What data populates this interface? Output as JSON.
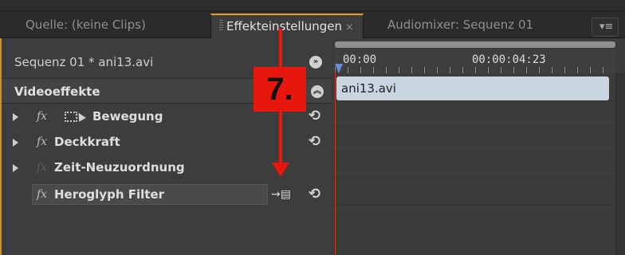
{
  "tabs": [
    {
      "label": "Quelle: (keine Clips)",
      "active": false
    },
    {
      "label": "Effekteinstellungen",
      "active": true
    },
    {
      "label": "Audiomixer: Sequenz 01",
      "active": false
    }
  ],
  "tab_close_glyph": "×",
  "panel_menu_glyph": "▾≡",
  "sequence": {
    "label": "Sequenz 01 * ani13.avi"
  },
  "section_header": {
    "label": "Videoeffekte"
  },
  "effects": [
    {
      "label": "Bewegung",
      "icon": "motion-icon",
      "fx_enabled": true,
      "expandable": true
    },
    {
      "label": "Deckkraft",
      "fx_enabled": true,
      "expandable": true
    },
    {
      "label": "Zeit-Neuzuordnung",
      "fx_enabled": false,
      "expandable": true
    },
    {
      "label": "Heroglyph Filter",
      "fx_enabled": true,
      "expandable": false,
      "selected": true
    }
  ],
  "fx_glyph": "fx",
  "reset_glyph": "⟲",
  "timeline": {
    "start_time": "00:00",
    "end_time": "00:00:04:23",
    "clip_name": "ani13.avi"
  },
  "annotation": {
    "label": "7."
  },
  "colors": {
    "accent_orange": "#d58e1c",
    "annotation_red": "#e8160c",
    "clip_blue": "#c9d5e0",
    "playhead": "#c0392b"
  }
}
